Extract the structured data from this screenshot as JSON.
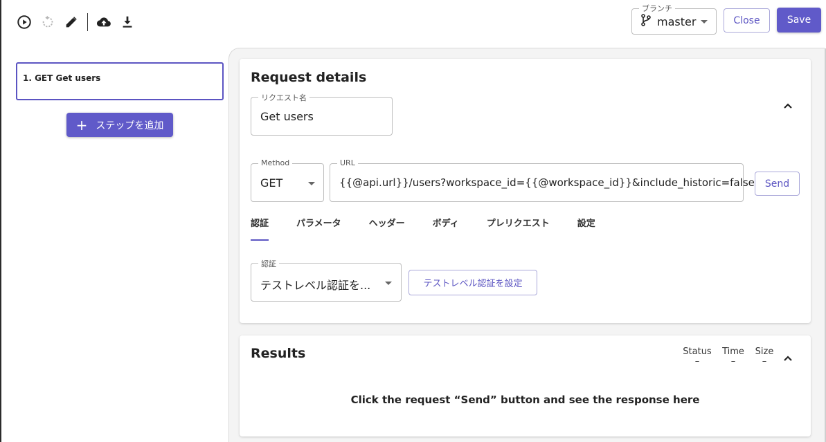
{
  "toolbar": {
    "icons": [
      "play-icon",
      "reset-icon",
      "edit-icon",
      "upload-cloud-icon",
      "download-icon"
    ]
  },
  "branch": {
    "legend": "ブランチ",
    "value": "master"
  },
  "actions": {
    "close_label": "Close",
    "save_label": "Save"
  },
  "steps": {
    "items": [
      {
        "label": "1. GET Get users"
      }
    ],
    "add_label": "ステップを追加"
  },
  "request": {
    "title": "Request details",
    "name_legend": "リクエスト名",
    "name_value": "Get users",
    "method_legend": "Method",
    "method_value": "GET",
    "url_legend": "URL",
    "url_value": "{{@api.url}}/users?workspace_id={{@workspace_id}}&include_historic=false",
    "send_label": "Send",
    "tabs": [
      "認証",
      "パラメータ",
      "ヘッダー",
      "ボディ",
      "プレリクエスト",
      "設定"
    ],
    "active_tab": "認証",
    "auth_legend": "認証",
    "auth_value": "テストレベル認証を...",
    "auth_button_label": "テストレベル認証を設定"
  },
  "results": {
    "title": "Results",
    "status_label": "Status",
    "status_value": "–",
    "time_label": "Time",
    "time_value": "–",
    "size_label": "Size",
    "size_value": "–",
    "empty_message": "Click the request “Send” button and see the response here"
  },
  "colors": {
    "accent": "#605ac9",
    "accent_border": "#a9a7d9"
  }
}
